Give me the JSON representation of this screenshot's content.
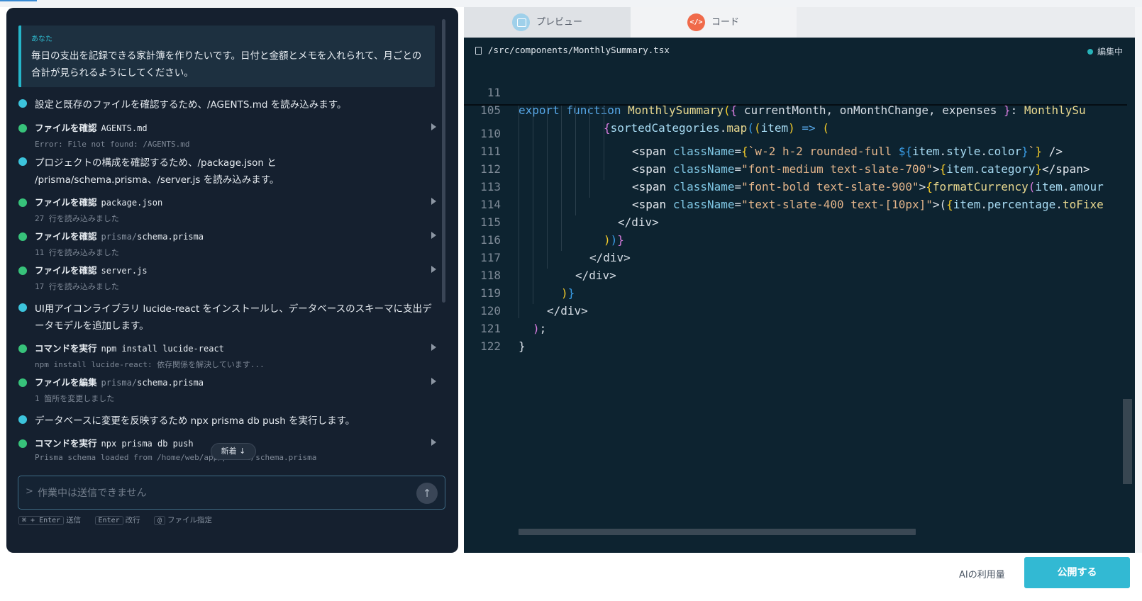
{
  "chat": {
    "user_label": "あなた",
    "user_message_line1": "毎日の支出を記録できる家計簿を作りたいです。日付と金額とメモを入れられて、月ごとの",
    "user_message_line2": "合計が見られるようにしてください。",
    "messages": [
      {
        "kind": "note",
        "text": "設定と既存のファイルを確認するため、/AGENTS.md を読み込みます。"
      },
      {
        "kind": "tool",
        "action": "ファイルを確認",
        "target": "AGENTS.md",
        "detail": "Error: File not found: /AGENTS.md"
      },
      {
        "kind": "note",
        "line1": "プロジェクトの構成を確認するため、/package.json と",
        "line2": "/prisma/schema.prisma、/server.js を読み込みます。"
      },
      {
        "kind": "tool",
        "action": "ファイルを確認",
        "target": "package.json",
        "detail": "27 行を読み込みました"
      },
      {
        "kind": "tool",
        "action": "ファイルを確認",
        "target_dir": "prisma/",
        "target": "schema.prisma",
        "detail": "11 行を読み込みました"
      },
      {
        "kind": "tool",
        "action": "ファイルを確認",
        "target": "server.js",
        "detail": "17 行を読み込みました"
      },
      {
        "kind": "note",
        "line1": "UI用アイコンライブラリ lucide-react をインストールし、データベースのスキーマに支出デ",
        "line2": "ータモデルを追加します。"
      },
      {
        "kind": "tool",
        "action": "コマンドを実行",
        "target": "npm install lucide-react",
        "detail": "npm install lucide-react: 依存関係を解決しています..."
      },
      {
        "kind": "tool",
        "action": "ファイルを編集",
        "target_dir": "prisma/",
        "target": "schema.prisma",
        "detail": "1 箇所を変更しました"
      },
      {
        "kind": "note",
        "text": "データベースに変更を反映するため npx prisma db push を実行します。"
      },
      {
        "kind": "tool",
        "action": "コマンドを実行",
        "target": "npx prisma db push",
        "detail": "Prisma schema loaded from /home/web/app/prisma/schema.prisma"
      }
    ],
    "new_badge": "新着 ↓",
    "input_prompt": ">",
    "input_placeholder": "作業中は送信できません",
    "send_icon": "↑",
    "hints": [
      {
        "key": "⌘ + Enter",
        "label": "送信"
      },
      {
        "key": "Enter",
        "label": "改行"
      },
      {
        "key": "@",
        "label": "ファイル指定"
      }
    ]
  },
  "tabs": {
    "preview": "プレビュー",
    "code": "コード",
    "code_icon": "</>"
  },
  "editor": {
    "path": "/src/components/MonthlySummary.tsx",
    "status": "編集中",
    "sticky": [
      {
        "num": "11",
        "text": "export function MonthlySummary({ currentMonth, onMonthChange, expenses }: MonthlySu"
      },
      {
        "num": "105",
        "text": "{sortedCategories.map((item) => ("
      }
    ],
    "lines": [
      {
        "num": "110",
        "text": "<span className={`w-2 h-2 rounded-full ${item.style.color}`} />"
      },
      {
        "num": "111",
        "text": "<span className=\"font-medium text-slate-700\">{item.category}</span>"
      },
      {
        "num": "112",
        "text": "<span className=\"font-bold text-slate-900\">{formatCurrency(item.amour"
      },
      {
        "num": "113",
        "text": "<span className=\"text-slate-400 text-[10px]\">({item.percentage.toFixe"
      },
      {
        "num": "114",
        "text": "</div>"
      },
      {
        "num": "115",
        "text": "))}"
      },
      {
        "num": "116",
        "text": "</div>"
      },
      {
        "num": "117",
        "text": "</div>"
      },
      {
        "num": "118",
        "text": ")}"
      },
      {
        "num": "119",
        "text": "</div>"
      },
      {
        "num": "120",
        "text": ");"
      },
      {
        "num": "121",
        "text": "}"
      },
      {
        "num": "122",
        "text": ""
      }
    ]
  },
  "footer": {
    "usage": "AIの利用量",
    "publish": "公開する"
  },
  "colors": {
    "accent": "#32b9d3",
    "panel_bg": "#15202f",
    "editor_bg": "#0d2330"
  }
}
